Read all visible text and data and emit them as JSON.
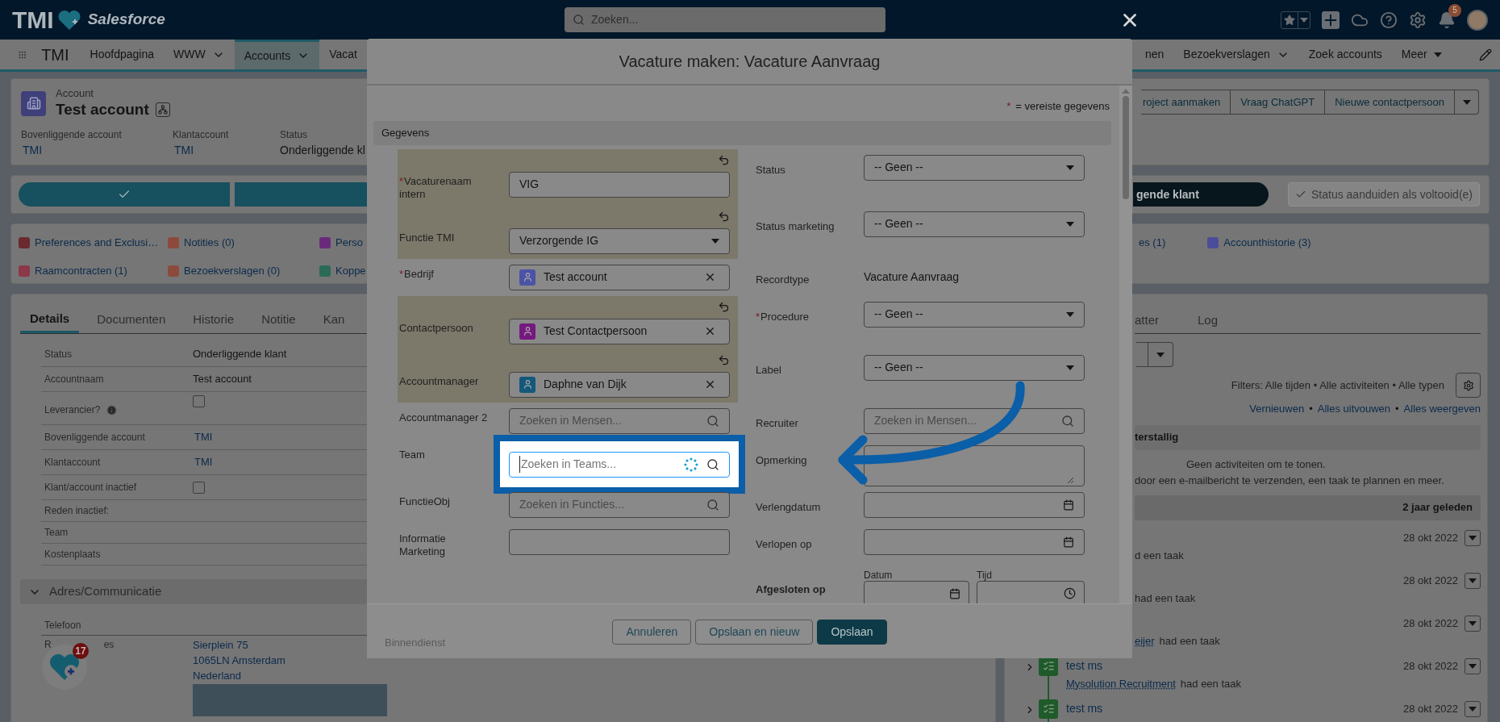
{
  "header": {
    "logo": "TMI",
    "logo_product": "Salesforce",
    "search_placeholder": "Zoeken...",
    "notifications": "5"
  },
  "nav": {
    "app_name": "TMI",
    "left_items": [
      {
        "label": "Hoofdpagina",
        "kind": "plain",
        "selected": false
      },
      {
        "label": "WWW",
        "kind": "chevron",
        "selected": false
      },
      {
        "label": "Accounts",
        "kind": "chevron",
        "selected": true
      },
      {
        "label": "Vacat",
        "kind": "plain",
        "selected": false
      }
    ],
    "right_items": [
      {
        "label": "nen",
        "kind": "plain",
        "selected": false
      },
      {
        "label": "Bezoekverslagen",
        "kind": "chevron",
        "selected": false
      },
      {
        "label": "Zoek accounts",
        "kind": "plain",
        "selected": false
      },
      {
        "label": "Meer",
        "kind": "triangle",
        "selected": false
      }
    ]
  },
  "account": {
    "object_label": "Account",
    "name": "Test account",
    "fields": [
      {
        "label": "Bovenliggende account",
        "value": "TMI",
        "kind": "link"
      },
      {
        "label": "Klantaccount",
        "value": "TMI",
        "kind": "link"
      },
      {
        "label": "Status",
        "value": "Onderliggende kl",
        "kind": "text"
      }
    ],
    "actions": [
      "roject aanmaken",
      "Vraag ChatGPT",
      "Nieuwe contactpersoon"
    ]
  },
  "path": {
    "stages": [
      {
        "complete": true
      },
      {
        "complete": false
      }
    ],
    "current_stage_button": "gende klant",
    "mark_complete_button": "Status aanduiden als voltooid(e)"
  },
  "related_lists": {
    "left": [
      {
        "label": "Preferences and Exclusi…",
        "color": "#6b2b2e"
      },
      {
        "label": "Notities (0)",
        "color": "#8c4a3c"
      },
      {
        "label": "Perso",
        "color": "#6a2a7c"
      },
      {
        "label": "Raamcontracten (1)",
        "color": "#8c3848"
      },
      {
        "label": "Bezoekverslagen (0)",
        "color": "#8c4a3c"
      },
      {
        "label": "Koppe",
        "color": "#2a6a56"
      }
    ],
    "right": [
      {
        "label": "es (1)"
      },
      {
        "label": "Accounthistorie (3)",
        "color": "#4b4c9a"
      }
    ]
  },
  "details": {
    "tabs": [
      {
        "label": "Details",
        "selected": true
      },
      {
        "label": "Documenten",
        "selected": false
      },
      {
        "label": "Historie",
        "selected": false
      },
      {
        "label": "Notitie",
        "selected": false
      },
      {
        "label": "Kan",
        "selected": false
      }
    ],
    "fields": [
      {
        "label": "Status",
        "kind": "text",
        "value": "Onderliggende klant",
        "info": false
      },
      {
        "label": "Accountnaam",
        "kind": "text",
        "value": "Test account",
        "info": false
      },
      {
        "label": "Leverancier?",
        "kind": "checkbox",
        "checked": false,
        "info": true
      },
      {
        "label": "Bovenliggende account",
        "kind": "link",
        "value": "TMI",
        "info": false
      },
      {
        "label": "Klantaccount",
        "kind": "link",
        "value": "TMI",
        "info": false
      },
      {
        "label": "Klant/account inactief",
        "kind": "checkbox",
        "checked": false,
        "info": false
      },
      {
        "label": "Reden inactief:",
        "kind": "empty",
        "info": false
      },
      {
        "label": "Team",
        "kind": "empty",
        "info": false
      },
      {
        "label": "Kostenplaats",
        "kind": "empty",
        "info": false
      }
    ],
    "address_section": {
      "title": "Adres/Communicatie",
      "expanded": true,
      "phone_label": "Telefoon",
      "postal_label_parts": [
        "R",
        "es"
      ],
      "postal_address": [
        "Sierplein 75",
        "1065LN Amsterdam",
        "Nederland"
      ]
    }
  },
  "floating_button": {
    "badge": "17"
  },
  "modal": {
    "title": "Vacature maken: Vacature Aanvraag",
    "required_mark": "*",
    "required_note": "= vereiste gegevens",
    "section": "Gegevens",
    "rows": [
      {
        "left": {
          "label": "Vacaturenaam intern",
          "required": true,
          "changed": true,
          "highlighted": false,
          "kind": "text",
          "value": "VIG"
        },
        "right": {
          "label": "Status",
          "required": false,
          "kind": "select",
          "value": "-- Geen --"
        }
      },
      {
        "left": {
          "label": "Functie TMI",
          "required": false,
          "changed": true,
          "highlighted": false,
          "kind": "select",
          "value": "Verzorgende IG"
        },
        "right": {
          "label": "Status marketing",
          "required": false,
          "kind": "select",
          "value": "-- Geen --"
        }
      },
      {
        "left": {
          "label": "Bedrijf",
          "required": true,
          "changed": false,
          "highlighted": false,
          "kind": "lookup",
          "value": "Test account",
          "color": "#4b53a6"
        },
        "right": {
          "label": "Recordtype",
          "required": false,
          "kind": "readonly",
          "value": "Vacature Aanvraag"
        }
      },
      {
        "left": {
          "label": "Contactpersoon",
          "required": false,
          "changed": true,
          "highlighted": false,
          "kind": "lookup",
          "value": "Test Contactpersoon",
          "color": "#74197f"
        },
        "right": {
          "label": "Procedure",
          "required": true,
          "kind": "select",
          "value": "-- Geen --"
        }
      },
      {
        "left": {
          "label": "Accountmanager",
          "required": false,
          "changed": true,
          "highlighted": false,
          "kind": "lookup",
          "value": "Daphne van Dijk",
          "color": "#14587a"
        },
        "right": {
          "label": "Label",
          "required": false,
          "kind": "select",
          "value": "-- Geen --"
        }
      },
      {
        "left": {
          "label": "Accountmanager 2",
          "required": false,
          "changed": false,
          "highlighted": false,
          "kind": "search",
          "placeholder": "Zoeken in Mensen...",
          "loading": false
        },
        "right": {
          "label": "Recruiter",
          "required": false,
          "kind": "search",
          "placeholder": "Zoeken in Mensen...",
          "loading": false
        }
      },
      {
        "left": {
          "label": "Team",
          "required": false,
          "changed": false,
          "highlighted": true,
          "kind": "search",
          "placeholder": "Zoeken in Teams...",
          "loading": true
        },
        "right": {
          "label": "Opmerking",
          "required": false,
          "kind": "textarea"
        }
      },
      {
        "left": {
          "label": "FunctieObj",
          "required": false,
          "changed": false,
          "highlighted": false,
          "kind": "search",
          "placeholder": "Zoeken in Functies...",
          "loading": false
        },
        "right": {
          "label": "Verlengdatum",
          "required": false,
          "kind": "date"
        }
      },
      {
        "left": {
          "label": "Informatie Marketing",
          "required": false,
          "changed": false,
          "highlighted": false,
          "kind": "text"
        },
        "right": {
          "label": "Verlopen op",
          "required": false,
          "kind": "date"
        }
      },
      {
        "right": {
          "label": "Afgesloten op",
          "required": false,
          "kind": "datetime",
          "date_label": "Datum",
          "time_label": "Tijd"
        }
      }
    ],
    "section_behind_footer": "Binnendienst",
    "buttons": [
      {
        "label": "Annuleren",
        "kind": "neutral"
      },
      {
        "label": "Opslaan en nieuw",
        "kind": "neutral"
      },
      {
        "label": "Opslaan",
        "kind": "brand"
      }
    ]
  },
  "activity": {
    "tabs": [
      {
        "label": "atter",
        "selected": false
      },
      {
        "label": "Log",
        "selected": false
      }
    ],
    "filters": "Filters: Alle tijden • Alle activiteiten • Alle typen",
    "links": [
      "Vernieuwen",
      "Alles uitvouwen",
      "Alles weergeven"
    ],
    "link_separator": "•",
    "overdue_title": "terstallig",
    "empty_lines": [
      "Geen activiteiten om te tonen.",
      "door een e-mailbericht te verzenden, een taak te plannen en meer."
    ],
    "group_title": "2 jaar geleden",
    "items": [
      {
        "date": "28 okt 2022",
        "text": "d een taak"
      },
      {
        "date": "28 okt 2022",
        "text": "had een taak"
      },
      {
        "date": "28 okt 2022",
        "actor": "eijer",
        "text": "had een taak"
      },
      {
        "date": "28 okt 2022",
        "title": "test ms",
        "actor": "Mysolution Recruitment",
        "text": "had een taak"
      },
      {
        "date": "28 okt 2022",
        "title": "test ms"
      }
    ]
  }
}
